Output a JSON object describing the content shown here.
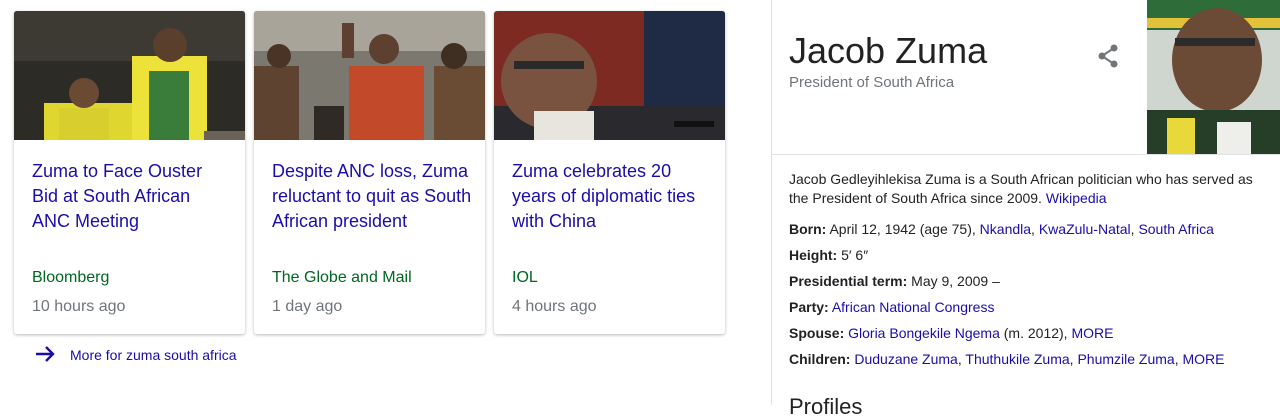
{
  "news": {
    "cards": [
      {
        "title": "Zuma to Face Ouster Bid at South African ANC Meeting",
        "source": "Bloomberg",
        "time": "10 hours ago"
      },
      {
        "title": "Despite ANC loss, Zuma reluctant to quit as South African president",
        "source": "The Globe and Mail",
        "time": "1 day ago"
      },
      {
        "title": "Zuma celebrates 20 years of diplomatic ties with China",
        "source": "IOL",
        "time": "4 hours ago"
      }
    ],
    "more_link": "More for zuma south africa"
  },
  "knowledge_panel": {
    "title": "Jacob Zuma",
    "subtitle": "President of South Africa",
    "description": "Jacob Gedleyihlekisa Zuma is a South African politician who has served as the President of South Africa since 2009.",
    "description_source": "Wikipedia",
    "facts": {
      "born_label": "Born:",
      "born_text": "April 12, 1942 (age 75),",
      "born_links": [
        "Nkandla",
        "KwaZulu-Natal",
        "South Africa"
      ],
      "height_label": "Height:",
      "height_value": "5′ 6″",
      "term_label": "Presidential term:",
      "term_value": "May 9, 2009 –",
      "party_label": "Party:",
      "party_value": "African National Congress",
      "spouse_label": "Spouse:",
      "spouse_value": "Gloria Bongekile Ngema",
      "spouse_extra": "(m. 2012),",
      "spouse_more": "MORE",
      "children_label": "Children:",
      "children": [
        "Duduzane Zuma",
        "Thuthukile Zuma",
        "Phumzile Zuma"
      ],
      "children_more": "MORE"
    },
    "profiles_heading": "Profiles"
  },
  "colors": {
    "link": "#1a0dab",
    "source": "#006621",
    "muted": "#70757a"
  }
}
